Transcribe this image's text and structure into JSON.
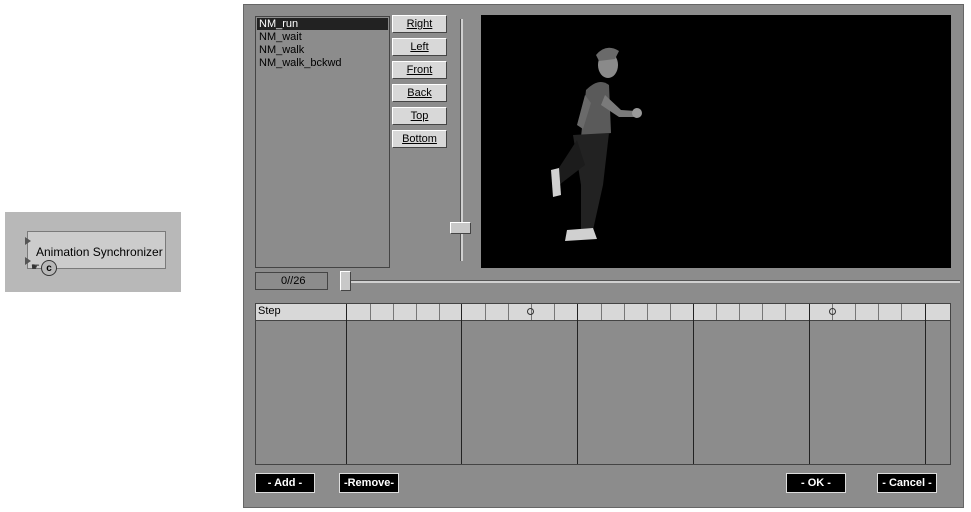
{
  "node": {
    "title": "Animation Synchronizer",
    "mark": "c"
  },
  "animations": [
    "NM_run",
    "NM_wait",
    "NM_walk",
    "NM_walk_bckwd"
  ],
  "selected_animation": "NM_run",
  "view_buttons": [
    "Right",
    "Left",
    "Front",
    "Back",
    "Top",
    "Bottom"
  ],
  "frame_counter": "0//26",
  "timeline": {
    "header": "Step"
  },
  "buttons": {
    "add": "-  Add  -",
    "remove": "-Remove-",
    "ok": "-  OK  -",
    "cancel": "- Cancel -"
  },
  "icons": {
    "keyframe": "circle-keyframe-icon",
    "pin": "input-pin-icon"
  }
}
